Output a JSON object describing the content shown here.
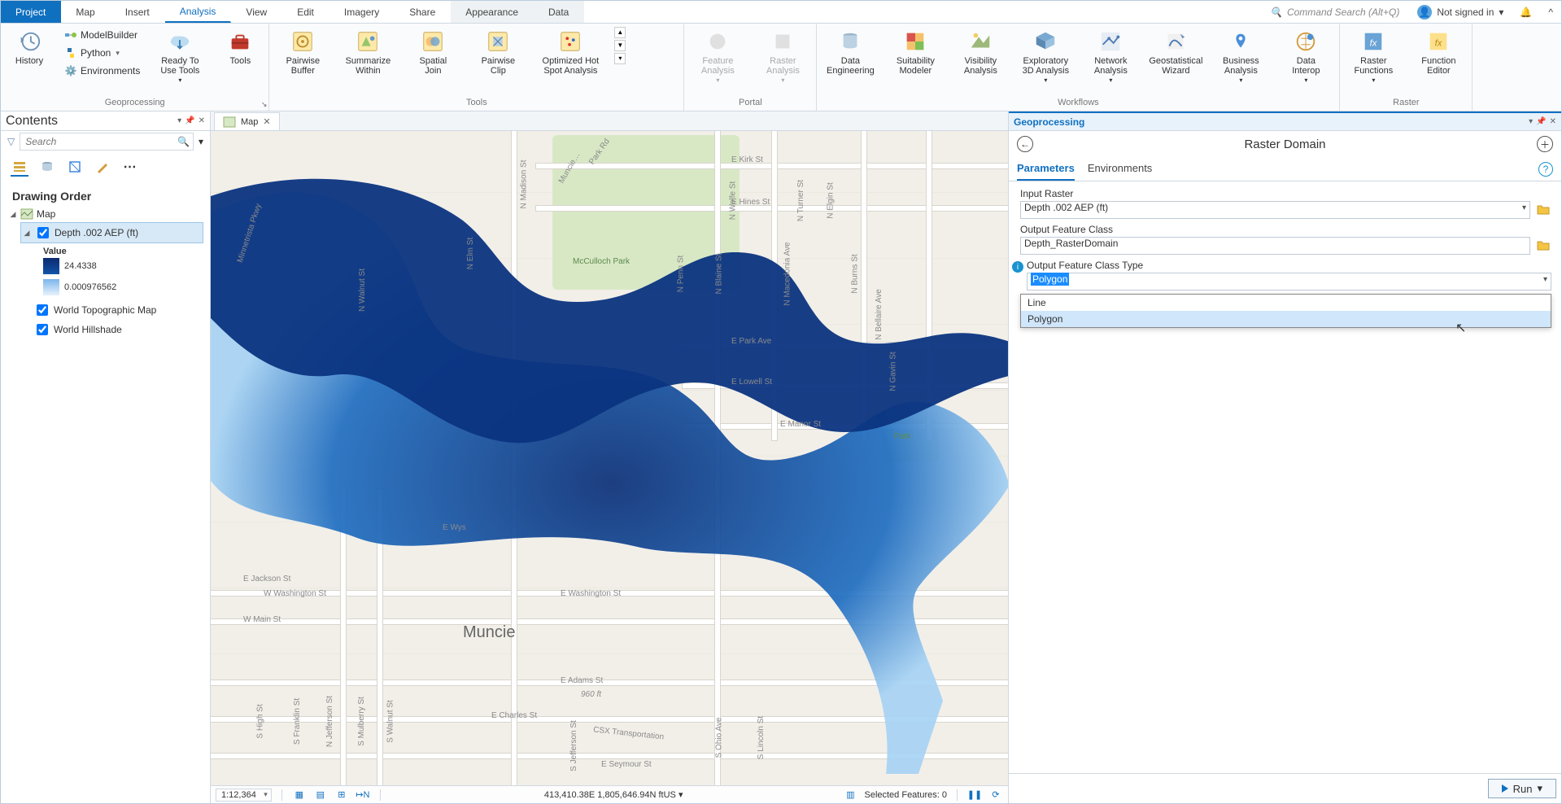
{
  "menu": {
    "tabs": [
      "Project",
      "Map",
      "Insert",
      "Analysis",
      "View",
      "Edit",
      "Imagery",
      "Share",
      "Appearance",
      "Data"
    ],
    "active_index": 3,
    "search_placeholder": "Command Search (Alt+Q)",
    "user_text": "Not signed in"
  },
  "ribbon": {
    "groups": {
      "geoprocessing": {
        "title": "Geoprocessing",
        "history": "History",
        "modelbuilder": "ModelBuilder",
        "python": "Python",
        "environments": "Environments",
        "ready": "Ready To\nUse Tools",
        "tools": "Tools"
      },
      "tools": {
        "title": "Tools",
        "items": [
          "Pairwise\nBuffer",
          "Summarize\nWithin",
          "Spatial\nJoin",
          "Pairwise\nClip",
          "Optimized Hot\nSpot Analysis"
        ]
      },
      "portal": {
        "title": "Portal",
        "feature": "Feature\nAnalysis",
        "raster": "Raster\nAnalysis"
      },
      "workflows": {
        "title": "Workflows",
        "items": [
          "Data\nEngineering",
          "Suitability\nModeler",
          "Visibility\nAnalysis",
          "Exploratory\n3D Analysis",
          "Network\nAnalysis",
          "Geostatistical\nWizard",
          "Business\nAnalysis",
          "Data\nInterop"
        ]
      },
      "raster": {
        "title": "Raster",
        "functions": "Raster\nFunctions",
        "editor": "Function\nEditor"
      }
    }
  },
  "contents": {
    "title": "Contents",
    "search_placeholder": "Search",
    "section": "Drawing Order",
    "map_node": "Map",
    "layers": [
      {
        "name": "Depth .002 AEP (ft)",
        "checked": true,
        "selected": true,
        "symbol": "depth",
        "values": {
          "label": "Value",
          "max": "24.4338",
          "min": "0.000976562"
        }
      },
      {
        "name": "World Topographic Map",
        "checked": true
      },
      {
        "name": "World Hillshade",
        "checked": true
      }
    ]
  },
  "map": {
    "tab_label": "Map",
    "city": "Muncie",
    "streets": [
      "E Kirk St",
      "E Hines St",
      "N Madison St",
      "McCulloch Park",
      "N Penn St",
      "N Blaine St",
      "N Macedonia Ave",
      "N Elm St",
      "W Washington St",
      "E Washington St",
      "W Main St",
      "E Adams St",
      "E Charles St",
      "E Seymour St",
      "E Park Ave",
      "E Lowell St",
      "E Manor St",
      "E Jackson St",
      "E Wys",
      "N Wolfe St",
      "N Turner St",
      "N Elgin St",
      "N Burns St",
      "N Bellaire Ave",
      "N Gavin St",
      "Minnetrista Pkwy",
      "Muncie…",
      "Park Rd",
      "CSX Transportation",
      "S Walnut St",
      "S Mulberry St",
      "N Jefferson St",
      "S Franklin St",
      "S High St",
      "N Walnut St",
      "S Ohio Ave",
      "S Lincoln St",
      "S Jefferson St",
      "960 ft",
      "Park"
    ],
    "status": {
      "scale": "1:12,364",
      "coords": "413,410.38E 1,805,646.94N ftUS",
      "selected": "Selected Features: 0"
    }
  },
  "gp": {
    "panel_title": "Geoprocessing",
    "tool_title": "Raster Domain",
    "tabs": [
      "Parameters",
      "Environments"
    ],
    "active_tab": 0,
    "fields": {
      "input_raster": {
        "label": "Input Raster",
        "value": "Depth .002 AEP (ft)"
      },
      "output_fc": {
        "label": "Output Feature Class",
        "value": "Depth_RasterDomain"
      },
      "output_type": {
        "label": "Output Feature Class Type",
        "value": "Polygon",
        "options": [
          "Line",
          "Polygon"
        ],
        "hover_index": 1
      }
    },
    "run": "Run"
  }
}
